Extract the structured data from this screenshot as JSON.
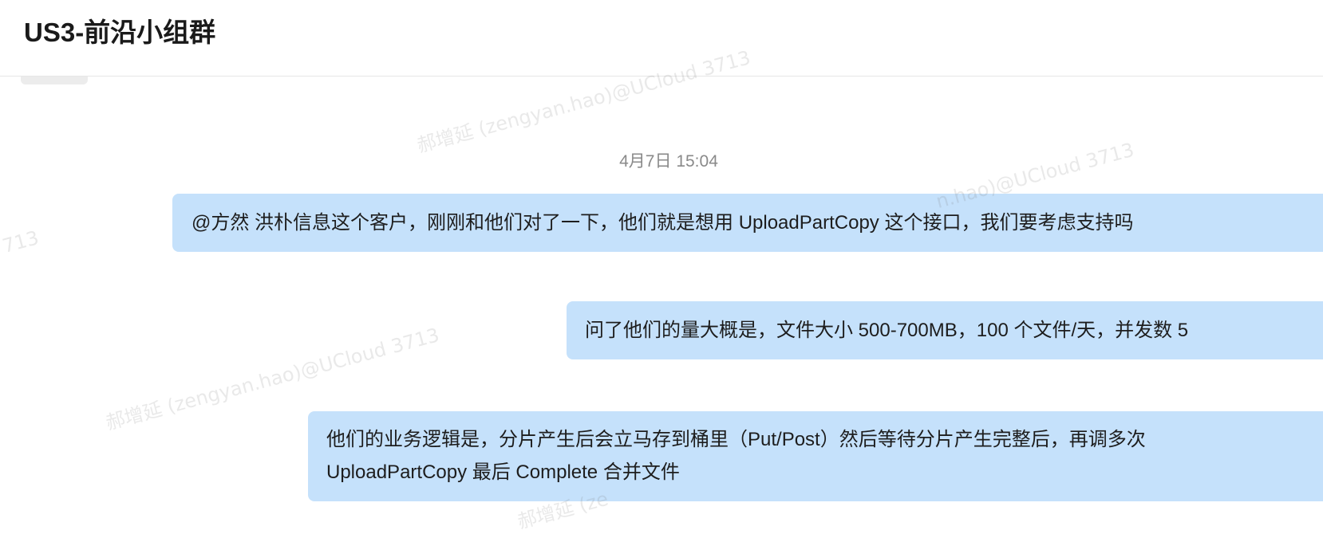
{
  "header": {
    "title": "US3-前沿小组群"
  },
  "chat": {
    "timestamp": "4月7日 15:04",
    "messages": [
      {
        "lines": [
          "@方然 洪朴信息这个客户，刚刚和他们对了一下，他们就是想用 UploadPartCopy 这个接口，我们要考虑支持吗"
        ]
      },
      {
        "lines": [
          "问了他们的量大概是，文件大小 500-700MB，100 个文件/天，并发数 5"
        ]
      },
      {
        "lines": [
          "他们的业务逻辑是，分片产生后会立马存到桶里（Put/Post）然后等待分片产生完整后，再调多次",
          "UploadPartCopy 最后 Complete 合并文件"
        ]
      }
    ]
  },
  "watermarks": [
    "郝增延 (zengyan.hao)@UCloud 3713",
    "n.hao)@UCloud 3713",
    "713",
    "郝增延 (zengyan.hao)@UCloud 3713",
    "郝增延 (ze"
  ],
  "colors": {
    "bubble": "#c5e1fb",
    "timestamp": "#8a8a8a",
    "title": "#1a1a1a"
  }
}
